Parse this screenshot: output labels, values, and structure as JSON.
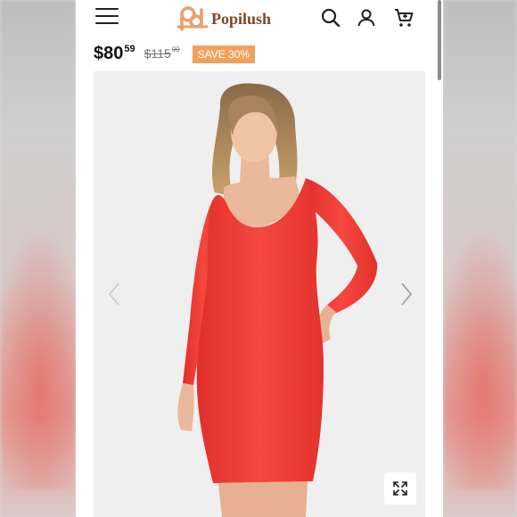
{
  "header": {
    "brand": "Popilush",
    "icons": [
      "menu-icon",
      "search-icon",
      "account-icon",
      "cart-icon"
    ]
  },
  "product": {
    "price_main": "$80",
    "price_cents": "59",
    "original_price": "$115",
    "original_cents": "00",
    "discount_badge": "SAVE 30%",
    "image_subject": "model wearing red long-sleeve square-neck bodycon mini dress"
  },
  "colors": {
    "brand": "#7a4a2a",
    "logo_mark": "#e9a06b",
    "badge": "#f0a25c",
    "dress": "#f23e36"
  }
}
